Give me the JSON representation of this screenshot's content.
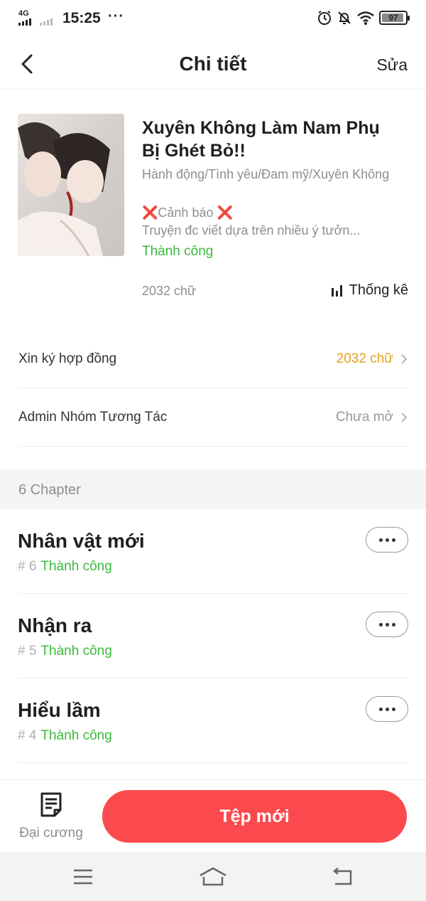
{
  "status_bar": {
    "network": "4G",
    "time": "15:25",
    "more": "···",
    "battery": "97",
    "icons": [
      "signal-icon",
      "alarm-icon",
      "mute-bell-icon",
      "wifi-icon",
      "battery-icon"
    ]
  },
  "header": {
    "back_icon": "chevron-left-icon",
    "title": "Chi tiết",
    "edit_label": "Sửa"
  },
  "book": {
    "title": "Xuyên Không Làm Nam Phụ Bị Ghét Bỏ!!",
    "genres": "Hành động/Tình yêu/Đam mỹ/Xuyên Không",
    "warning": "❌Cảnh báo ❌",
    "description": "Truyện đc viết dựa trên nhiều ý tưởn...",
    "status": "Thành công",
    "word_count": "2032 chữ",
    "stats_label": "Thống kê",
    "stats_icon": "bar-chart-icon"
  },
  "settings": [
    {
      "label": "Xin ký hợp đồng",
      "value": "2032 chữ",
      "value_color": "#e8a01a"
    },
    {
      "label": "Admin Nhóm Tương Tác",
      "value": "Chưa mở",
      "value_color": "#999999"
    }
  ],
  "chapters_header": "6 Chapter",
  "chapters": [
    {
      "title": "Nhân vật mới",
      "number": "# 6",
      "status": "Thành công"
    },
    {
      "title": "Nhận ra",
      "number": "# 5",
      "status": "Thành công"
    },
    {
      "title": "Hiểu lầm",
      "number": "# 4",
      "status": "Thành công"
    }
  ],
  "actions": {
    "outline_label": "Đại cương",
    "outline_icon": "document-list-icon",
    "new_file_label": "Tệp mới"
  },
  "colors": {
    "accent_red": "#fa4a4d",
    "success_green": "#3db83d",
    "orange": "#e8a01a"
  }
}
